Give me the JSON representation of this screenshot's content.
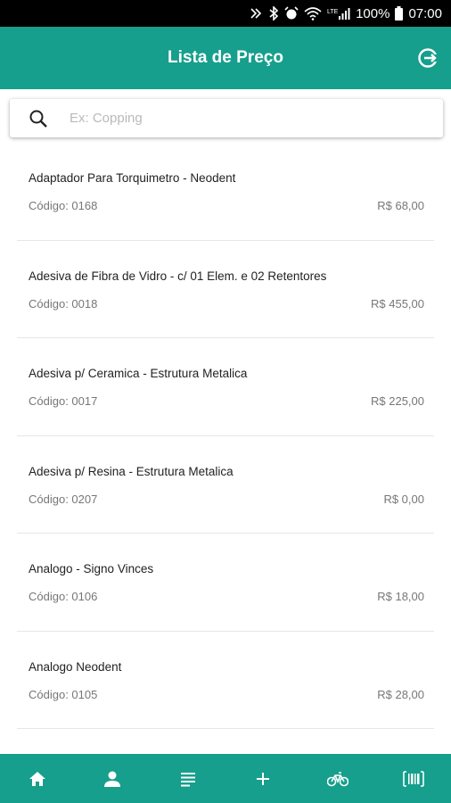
{
  "status_bar": {
    "battery": "100%",
    "time": "07:00",
    "network": "LTE"
  },
  "app_bar": {
    "title": "Lista de Preço",
    "action_icon": "logout-icon"
  },
  "search": {
    "placeholder": "Ex: Copping",
    "value": ""
  },
  "products": [
    {
      "name": "Adaptador Para Torquimetro - Neodent",
      "code": "Código: 0168",
      "price": "R$ 68,00"
    },
    {
      "name": "Adesiva de Fibra de Vidro - c/ 01 Elem. e 02 Retentores",
      "code": "Código: 0018",
      "price": "R$ 455,00"
    },
    {
      "name": "Adesiva p/ Ceramica - Estrutura Metalica",
      "code": "Código: 0017",
      "price": "R$ 225,00"
    },
    {
      "name": "Adesiva p/ Resina - Estrutura Metalica",
      "code": "Código: 0207",
      "price": "R$ 0,00"
    },
    {
      "name": "Analogo - Signo Vinces",
      "code": "Código: 0106",
      "price": "R$ 18,00"
    },
    {
      "name": "Analogo Neodent",
      "code": "Código: 0105",
      "price": "R$ 28,00"
    }
  ],
  "bottom_nav": {
    "items": [
      "home-icon",
      "profile-icon",
      "list-icon",
      "add-icon",
      "bike-icon",
      "barcode-icon"
    ]
  },
  "colors": {
    "primary": "#169f8c",
    "status_bar": "#000000",
    "text": "#222222",
    "muted_text": "#777777"
  }
}
